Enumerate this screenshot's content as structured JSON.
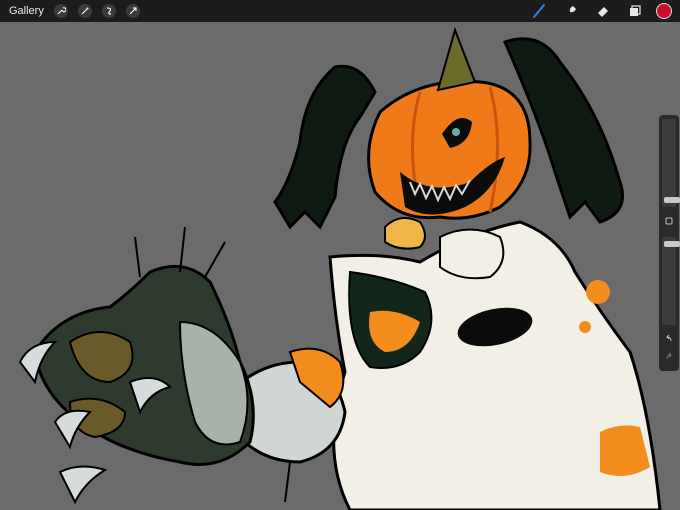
{
  "app": {
    "gallery_label": "Gallery"
  },
  "toolbar_left": [
    "wrench-icon",
    "magic-wand-icon",
    "selection-icon",
    "transform-icon"
  ],
  "toolbar_right": [
    "brush-icon",
    "smudge-icon",
    "eraser-icon",
    "layers-icon"
  ],
  "current_color": "#c8102e",
  "sidebar": {
    "brush_size": 0.05,
    "opacity": 0.95
  },
  "colors": {
    "accent": "#2f7fe8",
    "topbar": "#1c1c1c",
    "canvas": "#6b6b6b"
  }
}
